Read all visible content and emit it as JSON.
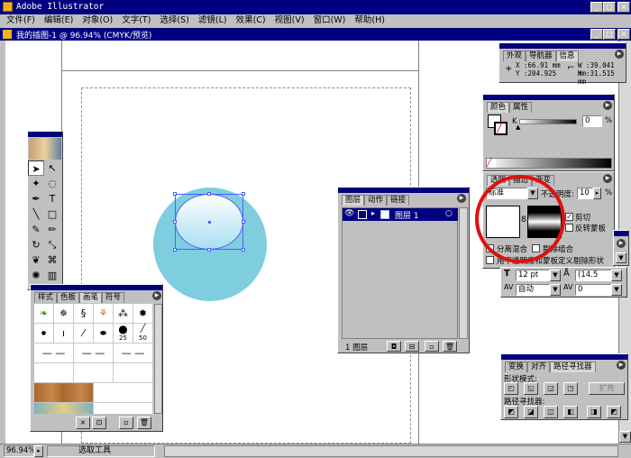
{
  "app": {
    "title": "Adobe Illustrator"
  },
  "menu": [
    "文件(F)",
    "编辑(E)",
    "对象(O)",
    "文字(T)",
    "选择(S)",
    "滤镜(L)",
    "效果(C)",
    "视图(V)",
    "窗口(W)",
    "帮助(H)"
  ],
  "document": {
    "title": "我的插图-1 @ 96.94% (CMYK/预览)"
  },
  "status": {
    "zoom": "96.94%",
    "tool": "选取工具"
  },
  "info_panel": {
    "tabs": [
      "外观",
      "导航器",
      "信息"
    ],
    "x": "X :66.91 mm",
    "y": "Y :204.925",
    "w": "W :39.041 mm",
    "h": "H :31.515 mm"
  },
  "color_panel": {
    "tabs": [
      "颜色",
      "属性"
    ],
    "k_label": "K",
    "k_value": "0",
    "percent": "%"
  },
  "transparency_panel": {
    "tabs": [
      "透明",
      "描边",
      "渐变"
    ],
    "blend_mode": "标准",
    "opacity_label": "不透明度:",
    "opacity_value": "10",
    "percent": "%",
    "clip_label": "剪切",
    "invert_mask_label": "反转蒙板",
    "isolate_blending_label": "分离混合",
    "knockout_group_label": "剔除组合",
    "opacity_mask_knockout_label": "用不透明度和蒙板定义剔除形状"
  },
  "character_panel": {
    "font_size": "12 pt",
    "leading": "(14.5",
    "tracking": "自动",
    "kerning": "0"
  },
  "layers_panel": {
    "tabs": [
      "图层",
      "动作",
      "链接"
    ],
    "layer_name": "图层 1",
    "footer": "1 图层"
  },
  "pathfinder_panel": {
    "tabs": [
      "变换",
      "对齐",
      "路径寻找器"
    ],
    "shape_modes_label": "形状模式:",
    "expand_label": "扩充",
    "pathfinders_label": "路径寻找器:"
  },
  "brush_panel": {
    "tabs": [
      "样式",
      "色板",
      "画笔",
      "符号"
    ],
    "sizes": [
      "25",
      "50"
    ]
  },
  "colors": {
    "circle": "#7ecee0",
    "titlebar": "#000080",
    "highlight": "#e01010",
    "mask_pink": "#a0208a"
  }
}
